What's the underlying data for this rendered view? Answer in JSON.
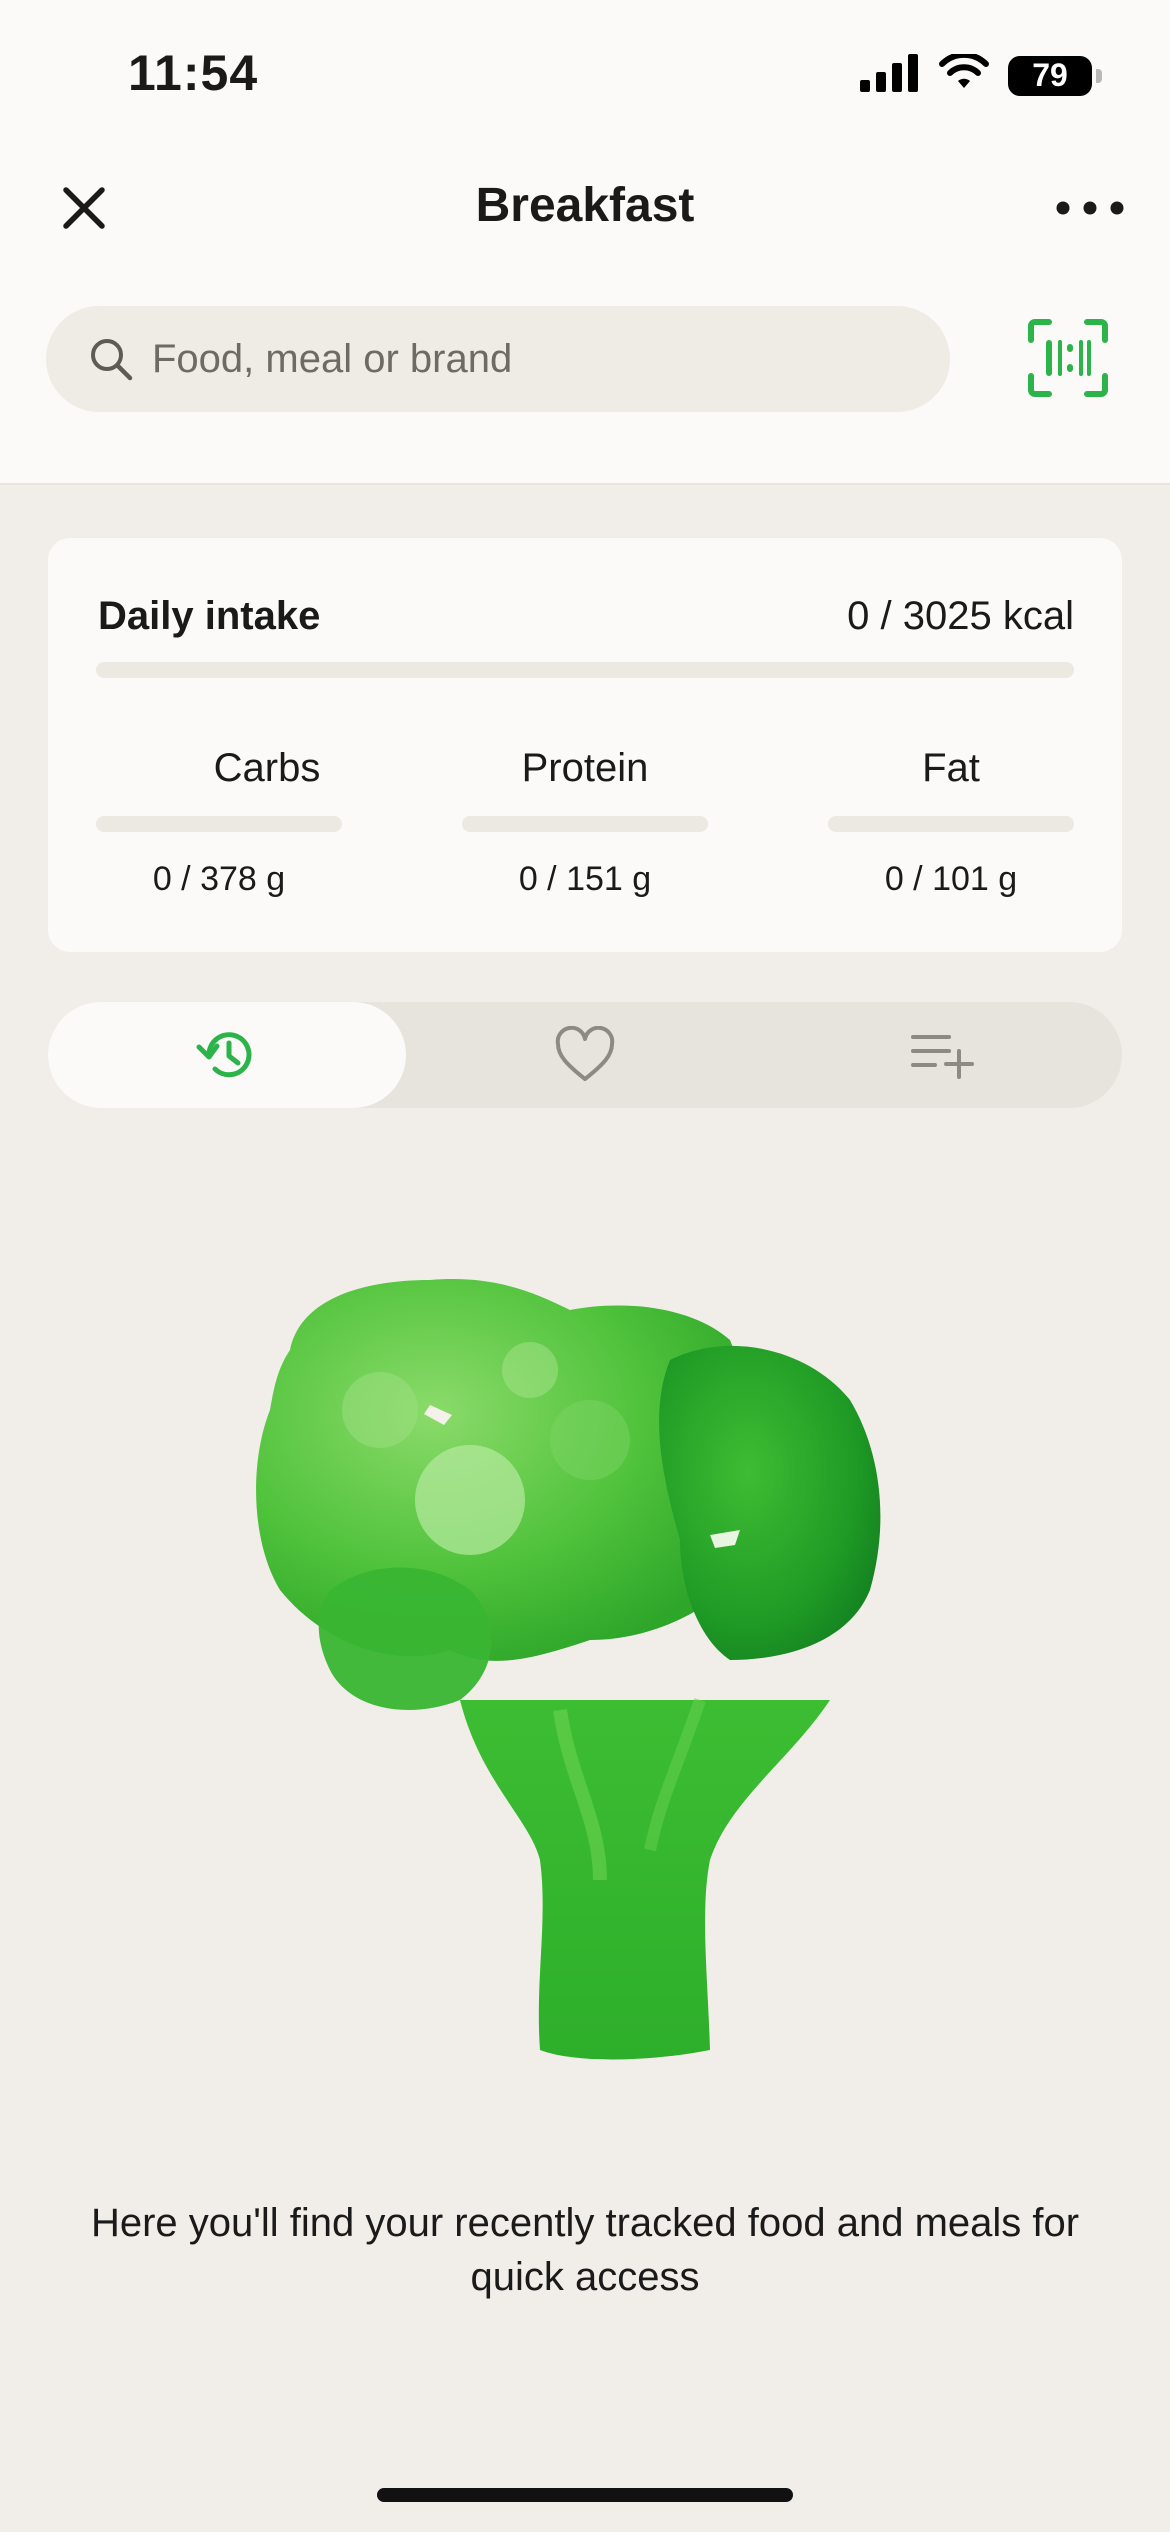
{
  "status_bar": {
    "time": "11:54",
    "battery": "79"
  },
  "nav": {
    "title": "Breakfast",
    "close_icon": "close-icon",
    "more_icon": "more-icon"
  },
  "search": {
    "placeholder": "Food, meal or brand",
    "value": ""
  },
  "intake": {
    "title": "Daily intake",
    "value": "0 / 3025 kcal",
    "progress": 0,
    "macros": [
      {
        "label": "Carbs",
        "value": "0 / 378 g",
        "progress": 0
      },
      {
        "label": "Protein",
        "value": "0 / 151 g",
        "progress": 0
      },
      {
        "label": "Fat",
        "value": "0 / 101 g",
        "progress": 0
      }
    ]
  },
  "tabs": [
    {
      "icon": "history-icon",
      "active": true
    },
    {
      "icon": "heart-icon",
      "active": false
    },
    {
      "icon": "add-list-icon",
      "active": false
    }
  ],
  "empty_state": {
    "message": "Here you'll find your recently tracked food and meals for quick access"
  },
  "colors": {
    "accent": "#2cb34a",
    "background": "#f1eee9",
    "surface": "#fbfaf8"
  }
}
